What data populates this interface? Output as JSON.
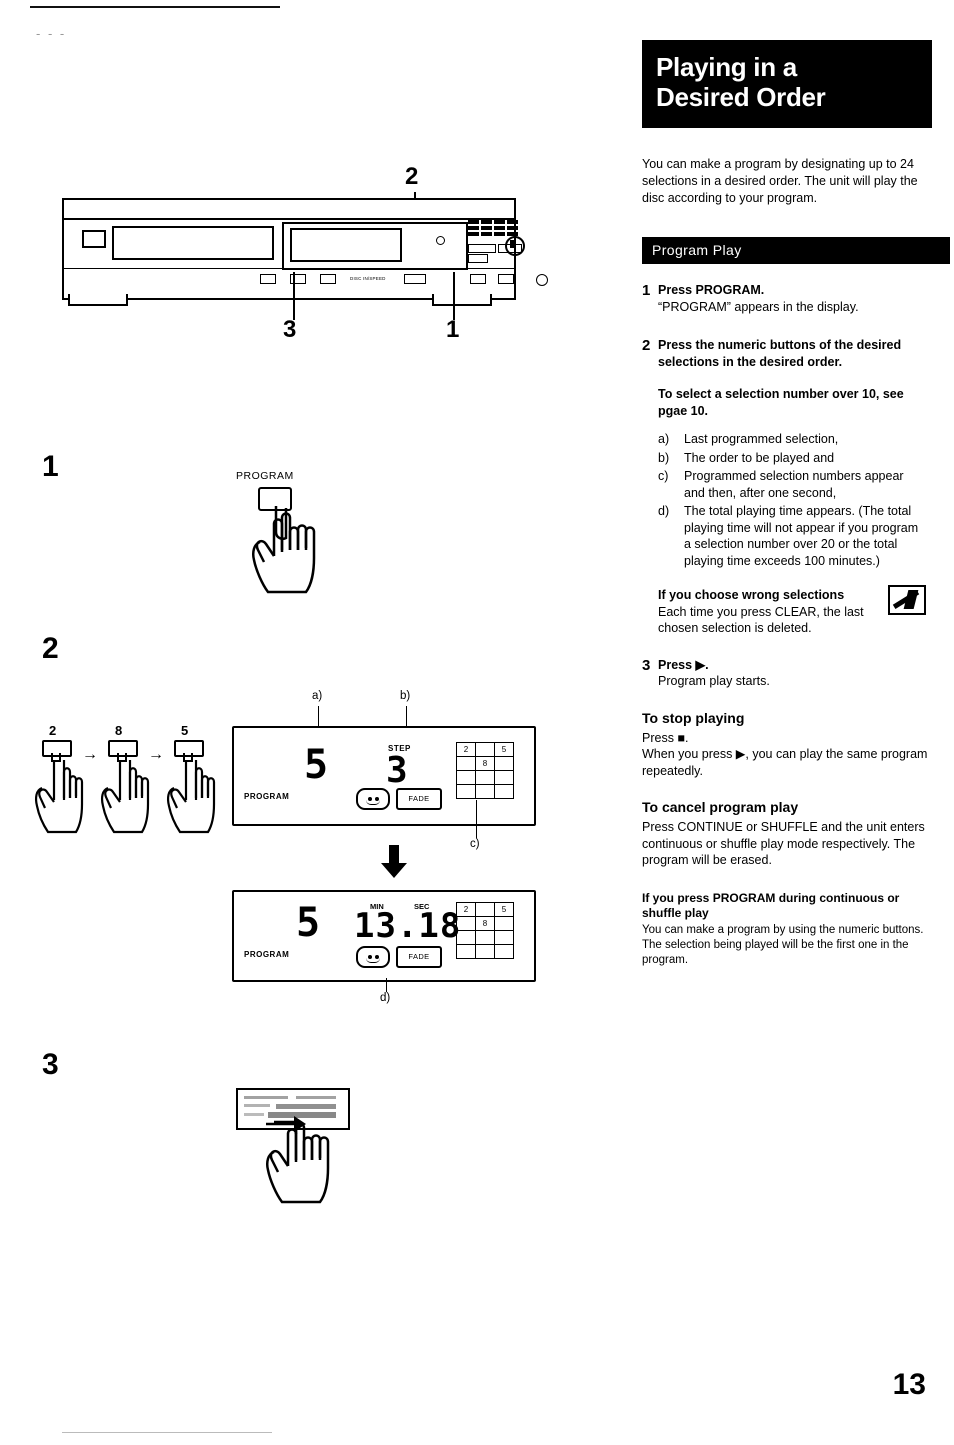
{
  "page": {
    "number": "13",
    "top_mark": "- - -",
    "bottom_mark": "",
    "bottom_mark_right": ""
  },
  "title": {
    "line1": "Playing in a",
    "line2": "Desired Order"
  },
  "intro": "You can make a program by designating up to 24 selections in a desired order. The unit will play the disc according to your program.",
  "section_bar": "Program Play",
  "steps": [
    {
      "num": "1",
      "bold": "Press PROGRAM.",
      "text": "“PROGRAM” appears in the display."
    },
    {
      "num": "2",
      "bold": "Press the numeric buttons of the desired selections in the desired order.",
      "text": ""
    },
    {
      "num": "3",
      "bold": "Press ▶.",
      "text": "Program play starts."
    }
  ],
  "note_over10": "To select a selection number over 10, see pgae 10.",
  "abc_list": [
    {
      "label": "a)",
      "text": "Last programmed selection,"
    },
    {
      "label": "b)",
      "text": "The order to be played and"
    },
    {
      "label": "c)",
      "text": "Programmed selection numbers appear and then, after one second,"
    },
    {
      "label": "d)",
      "text": "The total playing time appears. (The total playing time will not appear if you program a selection number over 20 or the total playing time exceeds 100 minutes.)"
    }
  ],
  "warning": {
    "heading": "If you choose wrong selections",
    "text": "Each time you press CLEAR, the last chosen selection is deleted."
  },
  "stop": {
    "heading": "To stop playing",
    "line1": "Press ■.",
    "line2": "When you press ▶, you can play the same program repeatedly."
  },
  "cancel": {
    "heading": "To cancel program play",
    "text": "Press CONTINUE or SHUFFLE and the unit enters continuous or shuffle play mode respectively. The program will be erased."
  },
  "continuous": {
    "heading": "If you press PROGRAM during continuous or shuffle play",
    "text": "You can make a program by using the numeric buttons. The selection being played will be the first one in the program."
  },
  "figure": {
    "unit_callouts": [
      "1",
      "2",
      "3"
    ],
    "unit_labels": {
      "bottom_small": "DISC IN/SPEED"
    },
    "step1": {
      "big_number": "1",
      "button_label": "PROGRAM"
    },
    "step2": {
      "big_number": "2",
      "keys": [
        "2",
        "8",
        "5"
      ],
      "arrow": "→",
      "callout_a": "a)",
      "callout_b": "b)",
      "callout_c": "c)",
      "callout_d": "d)",
      "display_top": {
        "program_text": "PROGRAM",
        "big_digit": "5",
        "step_label": "STEP",
        "step_digit": "3",
        "fade_label": "FADE",
        "grid": [
          [
            "2",
            "",
            "5"
          ],
          [
            "",
            "8",
            ""
          ],
          [
            "",
            "",
            ""
          ],
          [
            "",
            "",
            ""
          ]
        ]
      },
      "display_bottom": {
        "program_text": "PROGRAM",
        "big_digit": "5",
        "min_label": "MIN",
        "sec_label": "SEC",
        "time": "13.18",
        "fade_label": "FADE",
        "grid": [
          [
            "2",
            "",
            "5"
          ],
          [
            "",
            "8",
            ""
          ],
          [
            "",
            "",
            ""
          ],
          [
            "",
            "",
            ""
          ]
        ]
      }
    },
    "step3": {
      "big_number": "3"
    }
  }
}
